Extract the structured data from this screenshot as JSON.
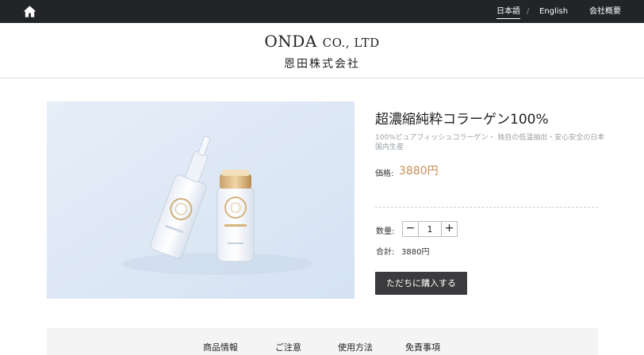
{
  "topbar": {
    "icon": "home-icon",
    "lang_ja": "日本語",
    "lang_sep": "/",
    "lang_en": "English",
    "company": "会社概要"
  },
  "header": {
    "brand_main": "ONDA",
    "brand_suffix": "CO., LTD",
    "brand_ja": "恩田株式会社"
  },
  "product": {
    "title": "超濃縮純粋コラーゲン100%",
    "description": "100%ピュアフィッシュコラーゲン・ 独自の低温抽出・安心安全の日本国内生産",
    "price_label": "価格:",
    "price": "3880円",
    "quantity_label": "数量:",
    "quantity_value": "1",
    "minus_label": "−",
    "plus_label": "+",
    "total_label": "合計:",
    "total": "3880円",
    "buy_label": "ただちに購入する"
  },
  "tabs": [
    "商品情報",
    "ご注意",
    "使用方法",
    "免責事項"
  ],
  "colors": {
    "topbar_bg": "#222427",
    "price": "#c88e55",
    "buy_button": "#3b3b3d",
    "photo_bg": "#dfe9f6"
  }
}
